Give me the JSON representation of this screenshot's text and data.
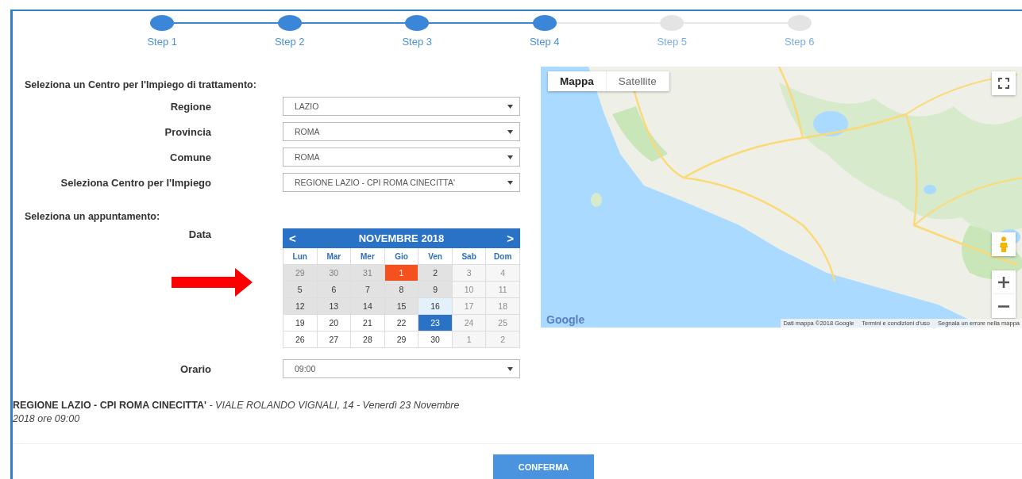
{
  "steps": [
    {
      "label": "Step 1",
      "done": true
    },
    {
      "label": "Step 2",
      "done": true
    },
    {
      "label": "Step 3",
      "done": true
    },
    {
      "label": "Step 4",
      "done": true
    },
    {
      "label": "Step 5",
      "done": false
    },
    {
      "label": "Step 6",
      "done": false
    }
  ],
  "centre_heading": "Seleziona un Centro per l'Impiego di trattamento:",
  "centre_fields": [
    {
      "label": "Regione",
      "value": "LAZIO"
    },
    {
      "label": "Provincia",
      "value": "ROMA"
    },
    {
      "label": "Comune",
      "value": "ROMA"
    },
    {
      "label": "Seleziona Centro per l'Impiego",
      "value": "REGIONE LAZIO - CPI ROMA CINECITTA'"
    }
  ],
  "appointment_heading": "Seleziona un appuntamento:",
  "date_label": "Data",
  "calendar": {
    "prev": "<",
    "month": "NOVEMBRE 2018",
    "next": ">",
    "weekdays": [
      "Lun",
      "Mar",
      "Mer",
      "Gio",
      "Ven",
      "Sab",
      "Dom"
    ],
    "weeks": [
      [
        {
          "day": "29",
          "kind": "outside"
        },
        {
          "day": "30",
          "kind": "outside"
        },
        {
          "day": "31",
          "kind": "outside"
        },
        {
          "day": "1",
          "kind": "today"
        },
        {
          "day": "2",
          "kind": "available"
        },
        {
          "day": "3",
          "kind": "disabled"
        },
        {
          "day": "4",
          "kind": "disabled"
        }
      ],
      [
        {
          "day": "5",
          "kind": "available"
        },
        {
          "day": "6",
          "kind": "available"
        },
        {
          "day": "7",
          "kind": "available"
        },
        {
          "day": "8",
          "kind": "available"
        },
        {
          "day": "9",
          "kind": "available"
        },
        {
          "day": "10",
          "kind": "disabled"
        },
        {
          "day": "11",
          "kind": "disabled"
        }
      ],
      [
        {
          "day": "12",
          "kind": "available"
        },
        {
          "day": "13",
          "kind": "available"
        },
        {
          "day": "14",
          "kind": "available"
        },
        {
          "day": "15",
          "kind": "available"
        },
        {
          "day": "16",
          "kind": "hover"
        },
        {
          "day": "17",
          "kind": "disabled"
        },
        {
          "day": "18",
          "kind": "disabled"
        }
      ],
      [
        {
          "day": "19",
          "kind": "plain"
        },
        {
          "day": "20",
          "kind": "plain"
        },
        {
          "day": "21",
          "kind": "plain"
        },
        {
          "day": "22",
          "kind": "plain"
        },
        {
          "day": "23",
          "kind": "selected"
        },
        {
          "day": "24",
          "kind": "disabled"
        },
        {
          "day": "25",
          "kind": "disabled"
        }
      ],
      [
        {
          "day": "26",
          "kind": "plain"
        },
        {
          "day": "27",
          "kind": "plain"
        },
        {
          "day": "28",
          "kind": "plain"
        },
        {
          "day": "29",
          "kind": "plain"
        },
        {
          "day": "30",
          "kind": "plain"
        },
        {
          "day": "1",
          "kind": "disabled"
        },
        {
          "day": "2",
          "kind": "disabled"
        }
      ]
    ]
  },
  "time_field": {
    "label": "Orario",
    "value": "09:00"
  },
  "summary": "**REGIONE LAZIO - CPI ROMA CINECITTA'** *- VIALE ROLANDO VIGNALI, 14 - Venerdì 23 Novembre 2018 ore 09:00*",
  "map": {
    "kind": "picture",
    "map_types": [
      {
        "label": "Mappa",
        "selected": true
      },
      {
        "label": "Satellite",
        "selected": false
      }
    ],
    "logo": "Google",
    "attribution": [
      "Dati mappa ©2018 Google",
      "Termini e condizioni d'uso",
      "Segnala un errore nella mappa"
    ]
  },
  "confirm_button": "CONFERMA"
}
